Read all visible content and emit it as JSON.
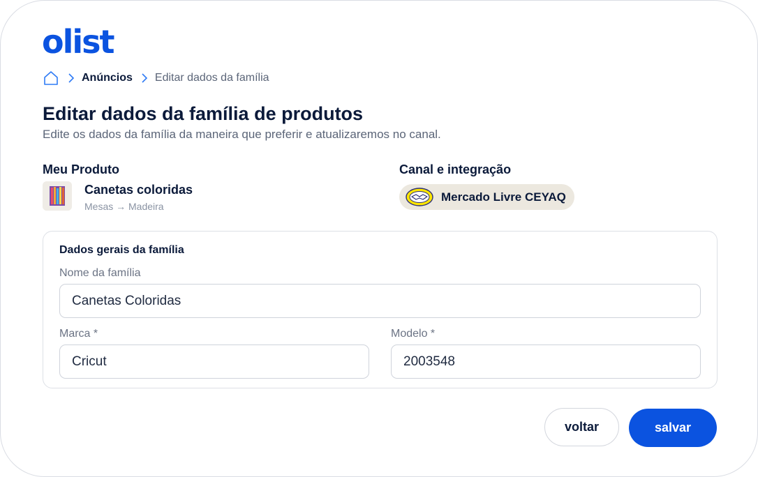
{
  "brand": {
    "logo_text": "olist",
    "primary_color": "#0b53e0",
    "accent_color": "#e6401f"
  },
  "breadcrumb": {
    "home_icon": "home-icon",
    "items": [
      {
        "label": "Anúncios"
      },
      {
        "label": "Editar dados da família"
      }
    ]
  },
  "page": {
    "title": "Editar dados da família de produtos",
    "subtitle": "Edite os dados da família da maneira que preferir e atualizaremos no canal."
  },
  "product": {
    "section_label": "Meu Produto",
    "name": "Canetas coloridas",
    "category_path": "Mesas → Madeira"
  },
  "channel": {
    "section_label": "Canal e integração",
    "name": "Mercado Livre CEYAQ",
    "icon": "mercado-livre-handshake-icon",
    "badge_color": "#ece8df",
    "icon_color": "#ffe600"
  },
  "form": {
    "panel_title": "Dados gerais da família",
    "family_name": {
      "label": "Nome da família",
      "value": "Canetas Coloridas"
    },
    "brand": {
      "label": "Marca *",
      "value": "Cricut"
    },
    "model": {
      "label": "Modelo *",
      "value": "2003548"
    }
  },
  "actions": {
    "back_label": "voltar",
    "save_label": "salvar"
  }
}
